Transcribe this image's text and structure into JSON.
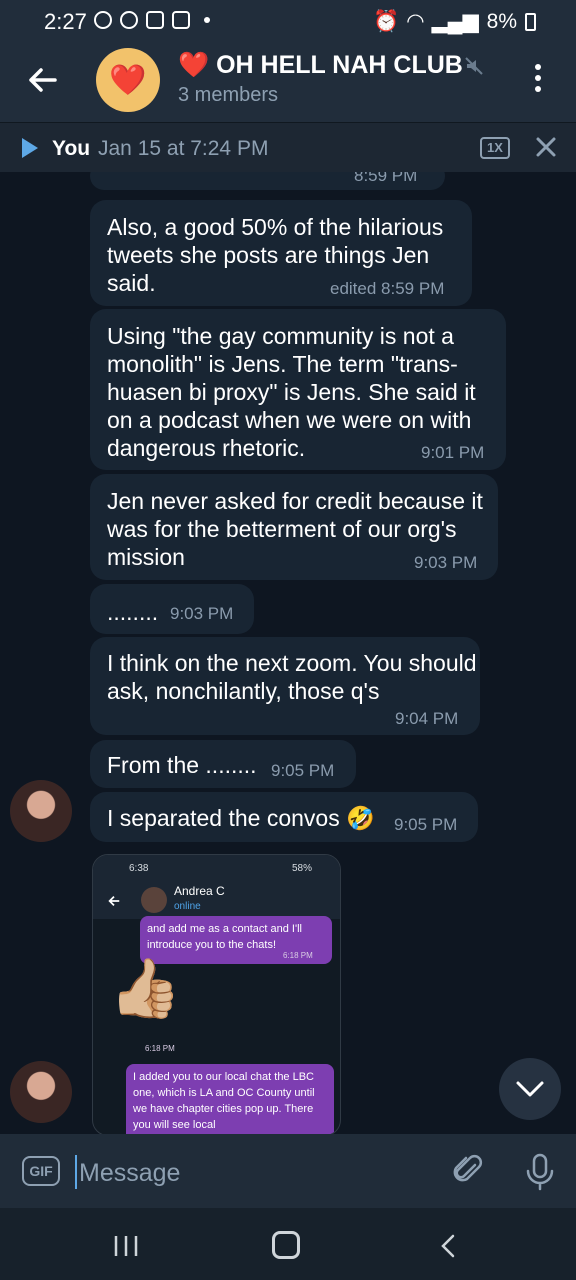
{
  "status_bar": {
    "time": "2:27",
    "battery": "8%"
  },
  "header": {
    "avatar": "❤️",
    "title": "❤️ OH HELL NAH CLUB",
    "subtitle": "3 members"
  },
  "player": {
    "sender": "You",
    "timestamp": "Jan 15 at 7:24 PM",
    "speed": "1X"
  },
  "messages": [
    {
      "time": "8:59 PM"
    },
    {
      "text": "Also, a good 50% of the hilarious tweets she posts are things Jen said.",
      "time": "edited 8:59 PM"
    },
    {
      "text": "Using \"the gay community is not a monolith\" is Jens. The term \"trans-huasen bi proxy\" is Jens. She said it on a podcast when we were on with dangerous rhetoric.",
      "time": "9:01 PM"
    },
    {
      "text": "Jen never asked for credit because it was for the betterment of our org's mission",
      "time": "9:03 PM"
    },
    {
      "text": "........",
      "time": "9:03 PM"
    },
    {
      "text": "I think on the next zoom. You should ask, nonchilantly, those q's",
      "time": "9:04 PM"
    },
    {
      "text": "From the ........",
      "time": "9:05 PM"
    },
    {
      "text": "I separated the convos 🤣",
      "time": "9:05 PM"
    }
  ],
  "screenshot": {
    "status_time": "6:38",
    "battery": "58%",
    "contact": "Andrea C",
    "status": "online",
    "message_1": "and add me as a contact and I'll introduce you to the chats!",
    "message_1_time": "6:18 PM",
    "emoji": "👍🏼",
    "emoji_time": "6:18 PM",
    "message_2": "I added you to our local chat the LBC one, which is LA and OC County until we have chapter cities pop up. There you will see local"
  },
  "composer": {
    "gif_label": "GIF",
    "placeholder": "Message"
  },
  "icons": [
    "back-arrow-icon",
    "mute-icon",
    "more-icon",
    "play-icon",
    "close-icon",
    "chevron-down-icon",
    "attach-icon",
    "microphone-icon"
  ],
  "colors": {
    "background": "#0e1621",
    "bubble": "#182533",
    "accent": "#5ea8e6",
    "purple": "#7d3eb1"
  }
}
